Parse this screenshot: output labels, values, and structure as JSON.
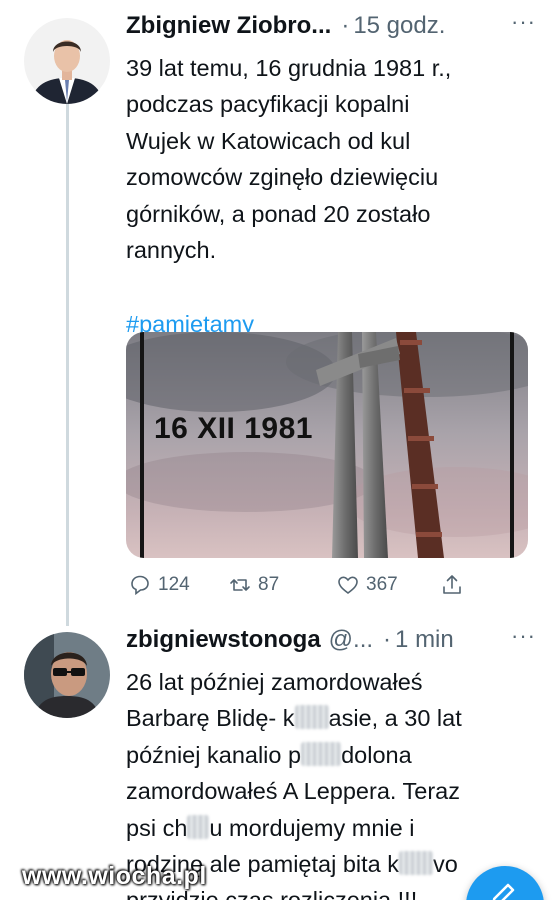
{
  "tweets": [
    {
      "name": "Zbigniew Ziobro...",
      "handle": "",
      "separator": "·",
      "time": "15 godz.",
      "more": "···",
      "lines": [
        "39 lat temu, 16 grudnia 1981 r.,",
        "podczas pacyfikacji kopalni",
        "Wujek w Katowicach od kul",
        "zomowców zginęło dziewięciu",
        "górników, a ponad 20 zostało",
        "rannych."
      ],
      "hashtag": "#pamiętamy",
      "media_text": "16 XII 1981",
      "actions": {
        "replies": "124",
        "retweets": "87",
        "likes": "367"
      }
    },
    {
      "name": "zbigniewstonoga",
      "handle": "@...",
      "separator": "·",
      "time": "1 min",
      "more": "···",
      "lines": [
        [
          "26 lat później zamordowałeś"
        ],
        [
          "Barbarę Blidę- k",
          "asie, a 30 lat"
        ],
        [
          "później kanalio p",
          "dolona"
        ],
        [
          "zamordowałeś A Leppera. Teraz"
        ],
        [
          "psi ch",
          "u mordujemy mnie i"
        ],
        [
          "rodzinę ale pamiętaj bita k",
          "vo"
        ],
        [
          "przyjdzie czas rozliczenia !!!"
        ]
      ]
    }
  ],
  "watermark": "www.wiocha.pl",
  "icons": {
    "reply": "reply-icon",
    "retweet": "retweet-icon",
    "like": "heart-icon",
    "share": "share-icon",
    "compose": "compose-icon"
  },
  "colors": {
    "accent": "#1d9bf0",
    "secondary_text": "#536471",
    "thread_line": "#cfd9de"
  }
}
